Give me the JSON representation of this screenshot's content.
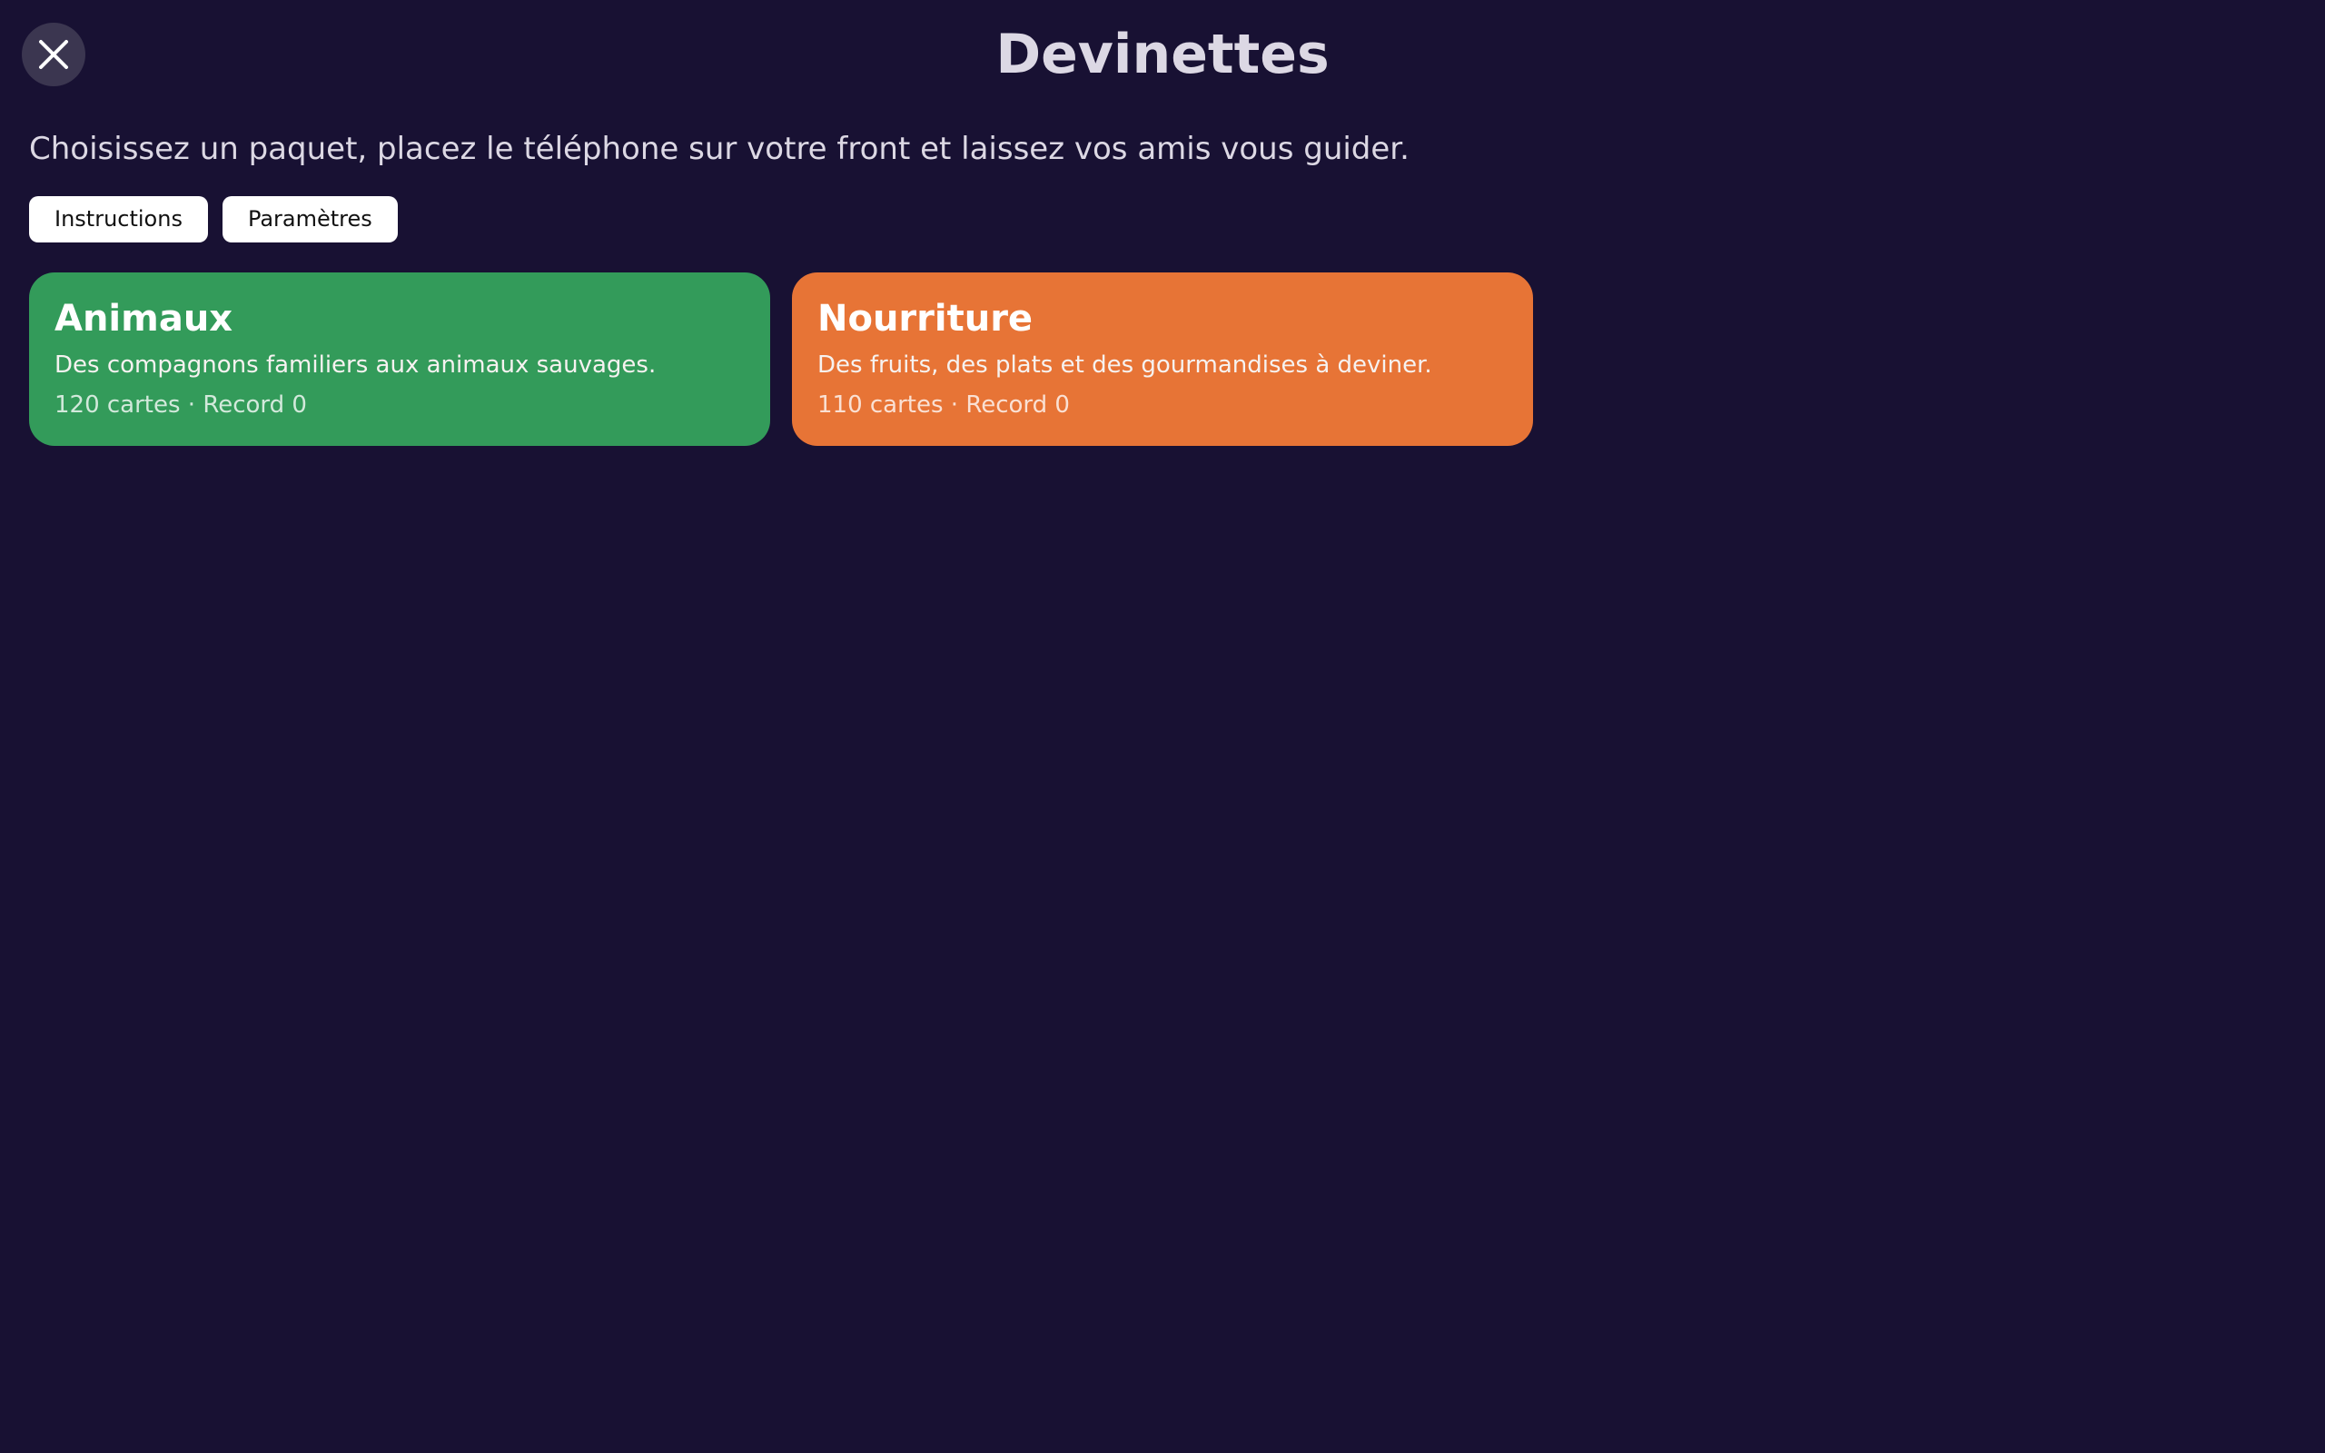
{
  "header": {
    "title": "Devinettes",
    "close_icon": "close-icon"
  },
  "intro": {
    "text": "Choisissez un paquet, placez le téléphone sur votre front et laissez vos amis vous guider."
  },
  "actions": {
    "instructions_label": "Instructions",
    "settings_label": "Paramètres"
  },
  "decks": [
    {
      "name": "Animaux",
      "description": "Des compagnons familiers aux animaux sauvages.",
      "meta": "120 cartes · Record 0",
      "color": "#339b5a"
    },
    {
      "name": "Nourriture",
      "description": "Des fruits, des plats et des gourmandises à deviner.",
      "meta": "110 cartes · Record 0",
      "color": "#e77436"
    }
  ],
  "colors": {
    "background": "#181133",
    "close_button": "#3b3650",
    "text": "#dcd8e4"
  }
}
